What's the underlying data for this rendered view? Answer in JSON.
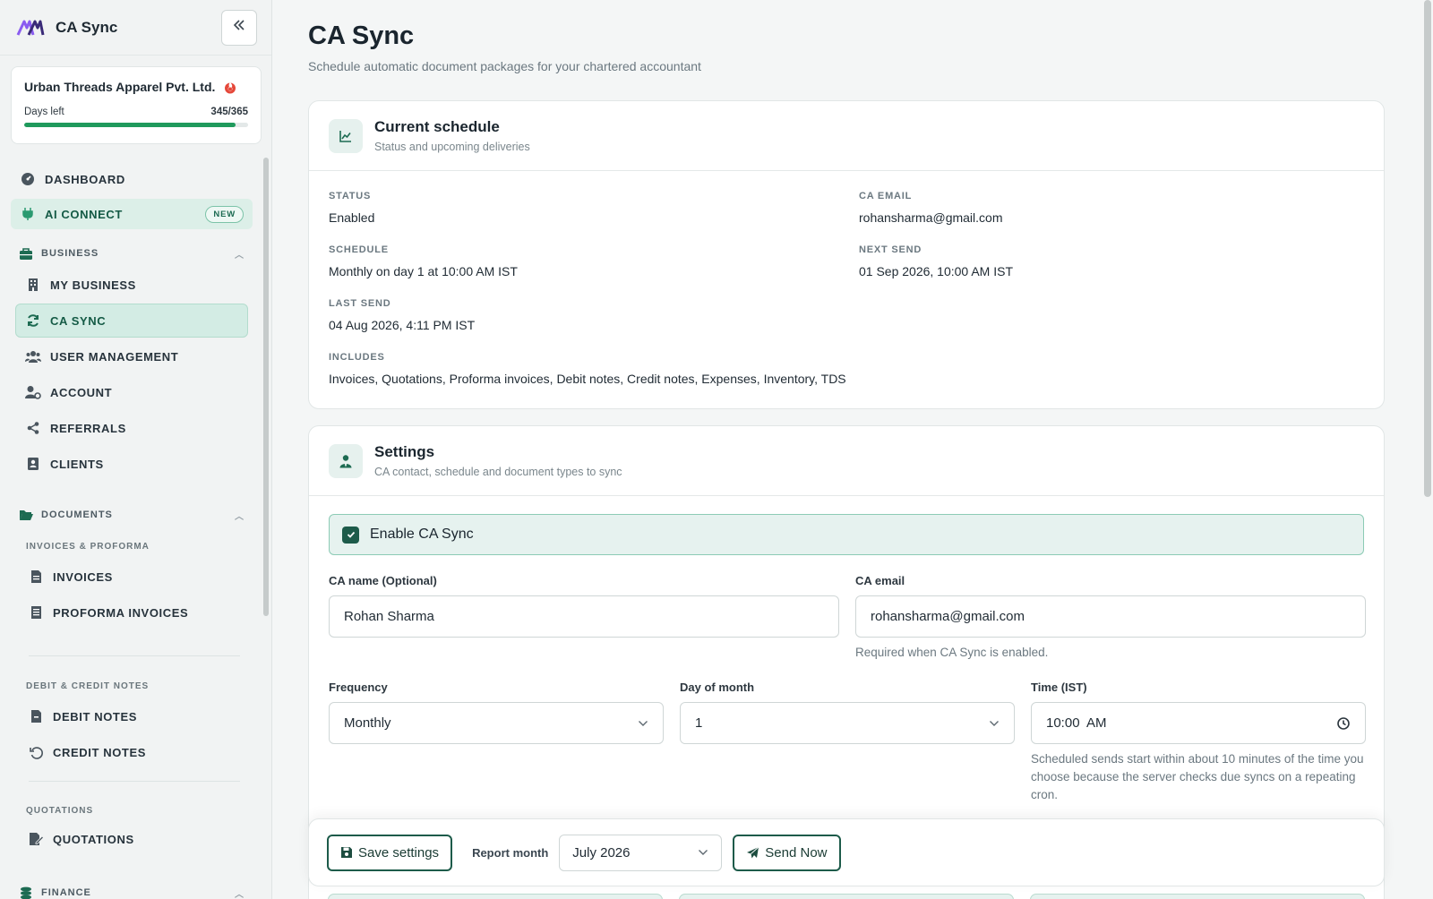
{
  "app": {
    "title": "CA Sync"
  },
  "org": {
    "name": "Urban Threads Apparel Pvt. Ltd.",
    "days_label": "Days left",
    "days_value": "345/365",
    "days_fraction": 0.945
  },
  "nav": {
    "dashboard": "DASHBOARD",
    "ai_connect": "AI CONNECT",
    "new_badge": "NEW",
    "business_head": "BUSINESS",
    "my_business": "MY BUSINESS",
    "ca_sync": "CA SYNC",
    "user_management": "USER MANAGEMENT",
    "account": "ACCOUNT",
    "referrals": "REFERRALS",
    "clients": "CLIENTS",
    "documents_head": "DOCUMENTS",
    "invoices_group": "INVOICES & PROFORMA",
    "invoices": "INVOICES",
    "proforma_invoices": "PROFORMA INVOICES",
    "notes_group": "DEBIT & CREDIT NOTES",
    "debit_notes": "DEBIT NOTES",
    "credit_notes": "CREDIT NOTES",
    "quotations_group": "QUOTATIONS",
    "quotations": "QUOTATIONS",
    "finance_head": "FINANCE"
  },
  "page": {
    "title": "CA Sync",
    "subtitle": "Schedule automatic document packages for your chartered accountant"
  },
  "schedule_card": {
    "title": "Current schedule",
    "subtitle": "Status and upcoming deliveries",
    "status_label": "STATUS",
    "status_value": "Enabled",
    "ca_email_label": "CA EMAIL",
    "ca_email_value": "rohansharma@gmail.com",
    "schedule_label": "SCHEDULE",
    "schedule_value": "Monthly on day 1 at 10:00 AM IST",
    "next_send_label": "NEXT SEND",
    "next_send_value": "01 Sep 2026, 10:00 AM IST",
    "last_send_label": "LAST SEND",
    "last_send_value": "04 Aug 2026, 4:11 PM IST",
    "includes_label": "INCLUDES",
    "includes_value": "Invoices, Quotations, Proforma invoices, Debit notes, Credit notes, Expenses, Inventory, TDS"
  },
  "settings_card": {
    "title": "Settings",
    "subtitle": "CA contact, schedule and document types to sync",
    "enable_label": "Enable CA Sync",
    "enabled": true,
    "ca_name_label": "CA name (Optional)",
    "ca_name_value": "Rohan Sharma",
    "ca_email_label": "CA email",
    "ca_email_value": "rohansharma@gmail.com",
    "ca_email_help": "Required when CA Sync is enabled.",
    "frequency_label": "Frequency",
    "frequency_value": "Monthly",
    "day_label": "Day of month",
    "day_value": "1",
    "time_label": "Time (IST)",
    "time_value": "10:00  AM",
    "time_help": "Scheduled sends start within about 10 minutes of the time you choose because the server checks due syncs on a repeating cron."
  },
  "actions": {
    "save_label": "Save settings",
    "report_month_label": "Report month",
    "report_month_value": "July 2026",
    "send_now_label": "Send Now"
  },
  "colors": {
    "accent": "#1d5b4a",
    "active_bg": "#d3ece4",
    "progress": "#1f9a5c"
  }
}
